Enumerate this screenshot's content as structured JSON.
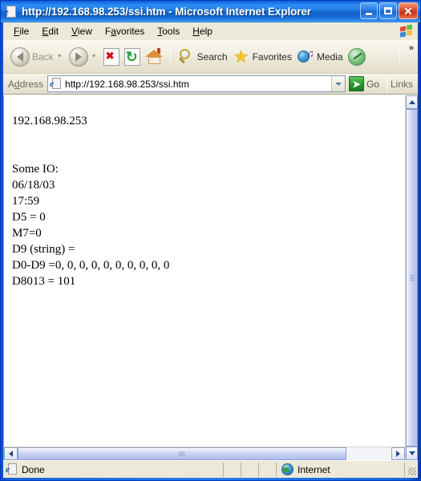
{
  "window": {
    "title_url": "http://192.168.98.253/ssi.htm",
    "title_suffix": " - Microsoft Internet Explorer",
    "icon": "ie-document-icon",
    "buttons": {
      "minimize": "minimize-button",
      "maximize": "maximize-button",
      "close": "close-button"
    }
  },
  "menubar": {
    "items": [
      {
        "label": "File",
        "accel": "F",
        "rest": "ile"
      },
      {
        "label": "Edit",
        "accel": "E",
        "rest": "dit"
      },
      {
        "label": "View",
        "accel": "V",
        "rest": "iew"
      },
      {
        "label": "Favorites",
        "pre": "F",
        "accel": "a",
        "rest": "vorites"
      },
      {
        "label": "Tools",
        "accel": "T",
        "rest": "ools"
      },
      {
        "label": "Help",
        "accel": "H",
        "rest": "elp"
      }
    ],
    "branding_icon": "windows-flag-icon"
  },
  "toolbar": {
    "back_label": "Back",
    "forward_label": "",
    "stop_label": "Stop",
    "refresh_label": "Refresh",
    "home_label": "Home",
    "search_label": "Search",
    "favorites_label": "Favorites",
    "media_label": "Media",
    "history_label": "History",
    "overflow_label": "»"
  },
  "addressbar": {
    "label": "Address",
    "label_pre": "A",
    "label_accel": "d",
    "label_rest": "dress",
    "url": "http://192.168.98.253/ssi.htm",
    "placeholder": "http://",
    "go_label": "Go",
    "links_label": "Links"
  },
  "content": {
    "lines": [
      "192.168.98.253",
      "",
      "",
      "Some IO:",
      "06/18/03",
      "17:59",
      "D5 = 0",
      "M7=0",
      "D9 (string) =",
      "D0-D9 =0, 0, 0, 0, 0, 0, 0, 0, 0, 0",
      "D8013 = 101"
    ]
  },
  "statusbar": {
    "status_text": "Done",
    "zone_text": "Internet",
    "status_icon": "ie-document-icon",
    "zone_icon": "internet-globe-icon"
  },
  "colors": {
    "titlebar_blue": "#1f7ae6",
    "chrome_beige": "#ece9d8",
    "content_bg": "#ffffff",
    "scrollbar_thumb": "#c3cdf0",
    "go_green": "#2f9e33",
    "stop_red": "#d4121b"
  }
}
